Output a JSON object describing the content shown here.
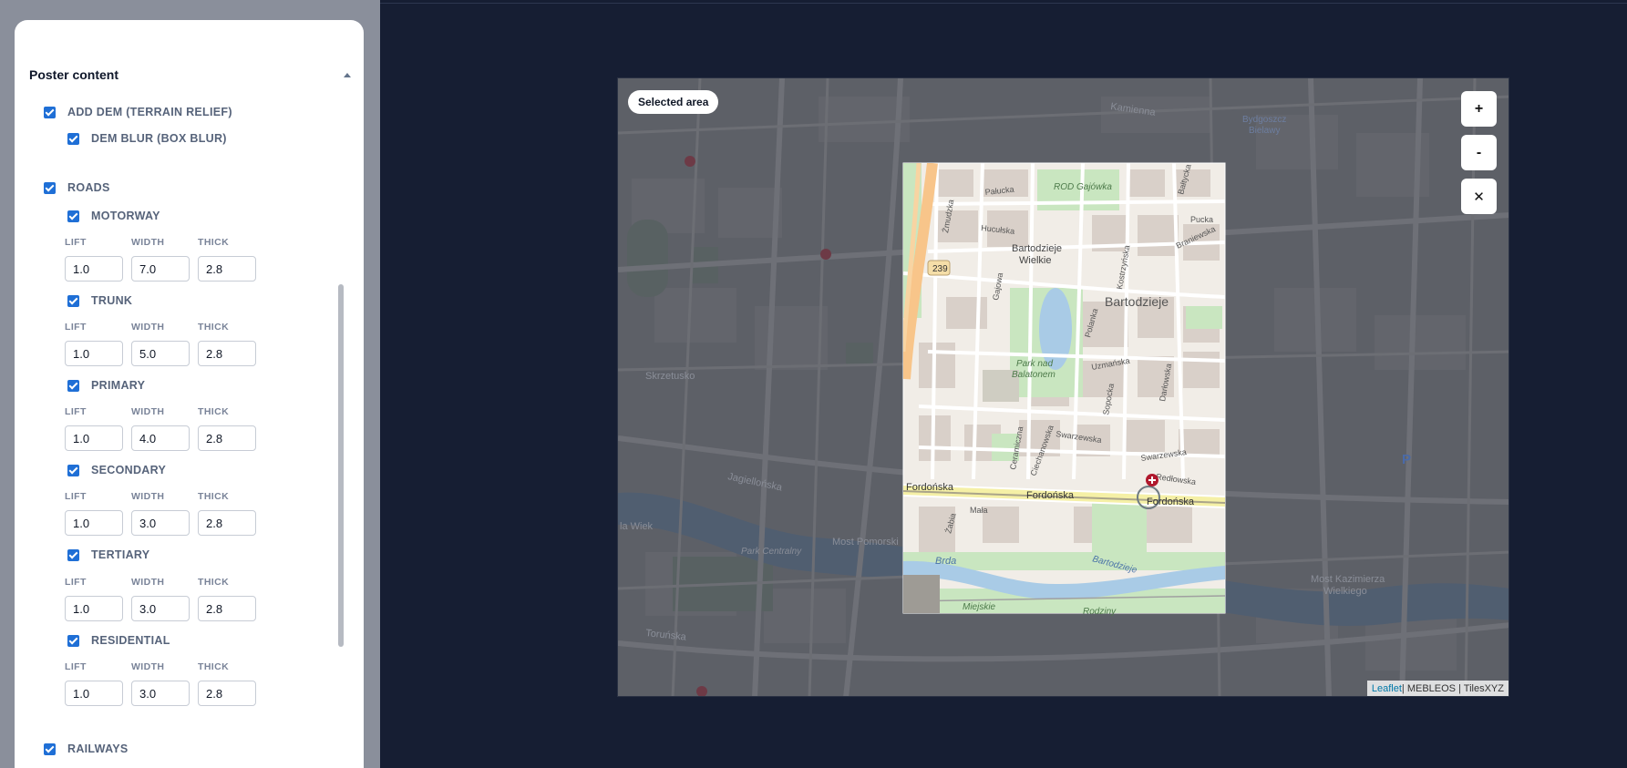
{
  "panel": {
    "title": "Poster content",
    "dem": {
      "label": "ADD DEM (TERRAIN RELIEF)",
      "blur_label": "DEM BLUR (BOX BLUR)"
    },
    "roads": {
      "label": "ROADS",
      "field_labels": {
        "lift": "LIFT",
        "width": "WIDTH",
        "thick": "THICK"
      },
      "items": [
        {
          "label": "MOTORWAY",
          "lift": "1.0",
          "width": "7.0",
          "thick": "2.8"
        },
        {
          "label": "TRUNK",
          "lift": "1.0",
          "width": "5.0",
          "thick": "2.8"
        },
        {
          "label": "PRIMARY",
          "lift": "1.0",
          "width": "4.0",
          "thick": "2.8"
        },
        {
          "label": "SECONDARY",
          "lift": "1.0",
          "width": "3.0",
          "thick": "2.8"
        },
        {
          "label": "TERTIARY",
          "lift": "1.0",
          "width": "3.0",
          "thick": "2.8"
        },
        {
          "label": "RESIDENTIAL",
          "lift": "1.0",
          "width": "3.0",
          "thick": "2.8"
        }
      ]
    },
    "railways": {
      "label": "RAILWAYS"
    }
  },
  "map": {
    "selected_area_label": "Selected area",
    "controls": {
      "zoom_in": "+",
      "zoom_out": "-",
      "close": "✕"
    },
    "attribution": {
      "leaflet": "Leaflet",
      "rest": " | MEBLEOS | TilesXYZ"
    },
    "labels": {
      "bartodzieje": "Bartodzieje",
      "bartodzieje_wielkie_1": "Bartodzieje",
      "bartodzieje_wielkie_2": "Wielkie",
      "rod_gajowka": "ROD Gajówka",
      "park_1": "Park nad",
      "park_2": "Balatonem",
      "fordonska_1": "Fordońska",
      "fordonska_2": "Fordońska",
      "fordonska_3": "Fordońska",
      "brda": "Brda",
      "bartodzieje_river": "Bartodzieje",
      "miejskie": "Miejskie",
      "rodziny": "Rodziny",
      "skrzetusko": "Skrzetusko",
      "jagiellonska": "Jagiellońska",
      "most_pomorski": "Most Pomorski",
      "park_centralny": "Park Centralny",
      "most_kazimierza_1": "Most Kazimierza",
      "most_kazimierza_2": "Wielkiego",
      "toruńska": "Toruńska",
      "kamienna": "Kamienna",
      "bydgoszcz_1": "Bydgoszcz",
      "bydgoszcz_2": "Bielawy",
      "road_239": "239",
      "parking": "P",
      "mala": "Mała",
      "zabia": "Żabia",
      "redlowska": "Redłowska",
      "swarzewska_1": "Swarzewska",
      "swarzewska_2": "Swarzewska",
      "uzmanska": "Uzmańska",
      "polanka": "Polanka",
      "gajowa": "Gajowa",
      "zmudzka": "Żmudzka",
      "palucka": "Pałucka",
      "hucul": "Hucułska",
      "baltycka": "Bałtycka",
      "branewska": "Braniewska",
      "pucka": "Pucka",
      "sopocka": "Sopocka",
      "darlowska": "Darłowska",
      "ceramiczna": "Ceramiczna",
      "ciechanowska": "Ciechanowska",
      "kosciuszki": "Kostrzyńska",
      "la_wiek": "la Wiek"
    }
  }
}
